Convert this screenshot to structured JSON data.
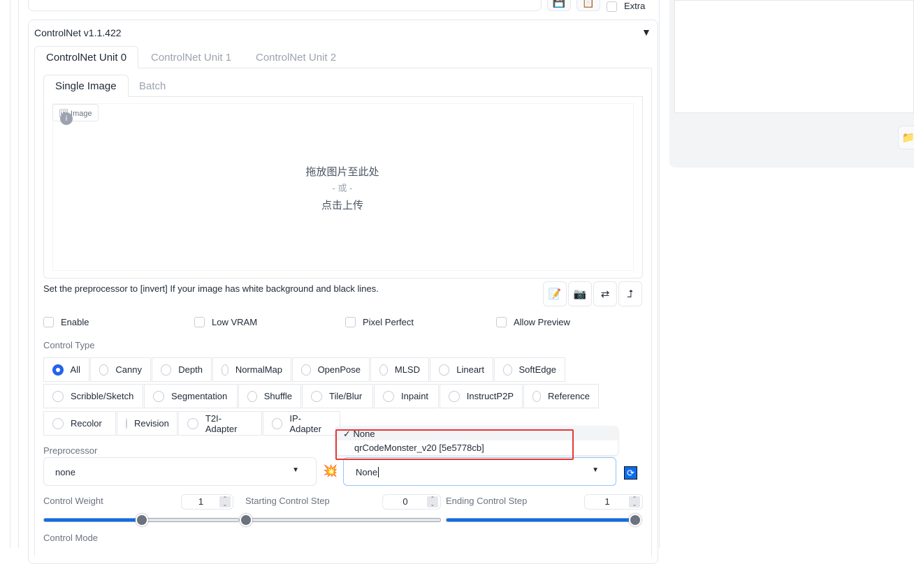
{
  "top": {
    "extra_label": "Extra"
  },
  "controlnet": {
    "title": "ControlNet v1.1.422",
    "unit_tabs": [
      "ControlNet Unit 0",
      "ControlNet Unit 1",
      "ControlNet Unit 2"
    ],
    "image_tabs": [
      "Single Image",
      "Batch"
    ],
    "image_label": "Image",
    "drop_text": [
      "拖放图片至此处",
      "- 或 -",
      "点击上传"
    ],
    "hint": "Set the preprocessor to [invert] If your image has white background and black lines.",
    "checkboxes": [
      {
        "label": "Enable",
        "checked": false
      },
      {
        "label": "Low VRAM",
        "checked": false
      },
      {
        "label": "Pixel Perfect",
        "checked": false
      },
      {
        "label": "Allow Preview",
        "checked": false
      }
    ],
    "control_type_label": "Control Type",
    "control_types": [
      "All",
      "Canny",
      "Depth",
      "NormalMap",
      "OpenPose",
      "MLSD",
      "Lineart",
      "SoftEdge",
      "Scribble/Sketch",
      "Segmentation",
      "Shuffle",
      "Tile/Blur",
      "Inpaint",
      "InstructP2P",
      "Reference",
      "Recolor",
      "Revision",
      "T2I-Adapter",
      "IP-Adapter"
    ],
    "control_type_selected": "All",
    "preprocessor_label": "Preprocessor",
    "preprocessor_value": "none",
    "model_value": "None",
    "model_options": [
      {
        "label": "None",
        "checked": true
      },
      {
        "label": "qrCodeMonster_v20 [5e5778cb]",
        "checked": false
      }
    ],
    "control_weight": {
      "label": "Control Weight",
      "value": "1",
      "min": 0,
      "max": 2
    },
    "starting_step": {
      "label": "Starting Control Step",
      "value": "0",
      "min": 0,
      "max": 1
    },
    "ending_step": {
      "label": "Ending Control Step",
      "value": "1",
      "min": 0,
      "max": 1
    },
    "control_mode_label": "Control Mode",
    "highlight_color": "#e53935"
  }
}
